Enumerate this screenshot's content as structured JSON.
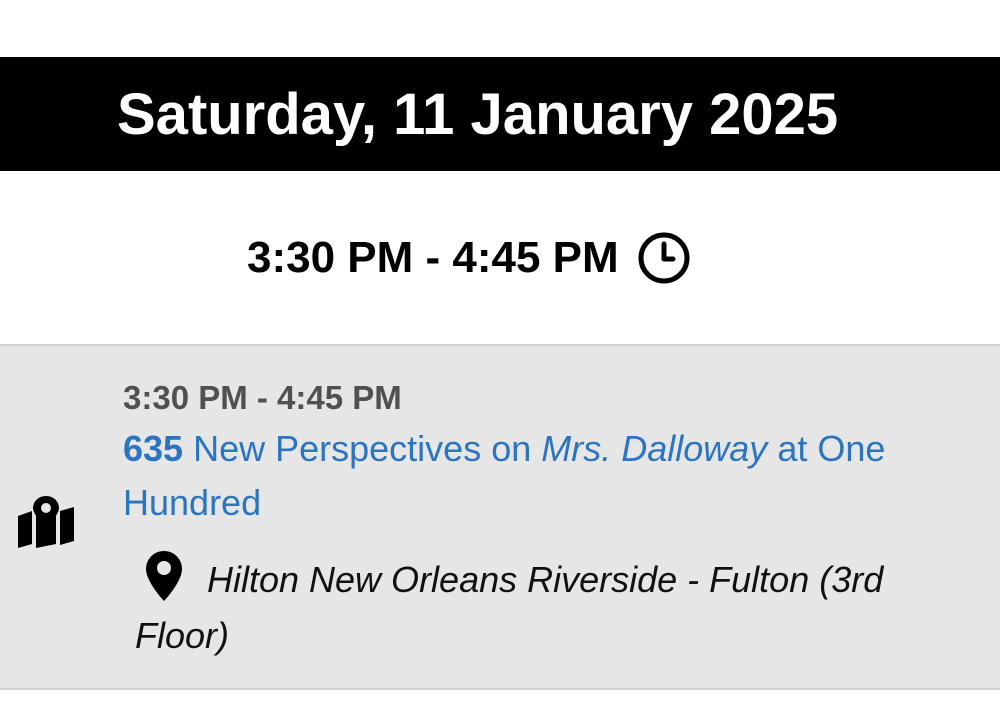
{
  "header": {
    "date": "Saturday, 11 January 2025"
  },
  "time_block": {
    "range": "3:30 PM - 4:45 PM",
    "icon": "clock-icon"
  },
  "session": {
    "time": "3:30 PM - 4:45 PM",
    "number": "635",
    "title_before": "New Perspectives on",
    "title_italic": "Mrs. Dalloway",
    "title_after": "at One Hundred",
    "location": "Hilton New Orleans Riverside - Fulton (3rd Floor)",
    "map_icon": "map-marker-icon",
    "pin_icon": "location-pin-icon"
  },
  "colors": {
    "header_bg": "#000000",
    "card_bg": "#e6e6e6",
    "link": "#2a74c2",
    "muted_text": "#505050"
  }
}
